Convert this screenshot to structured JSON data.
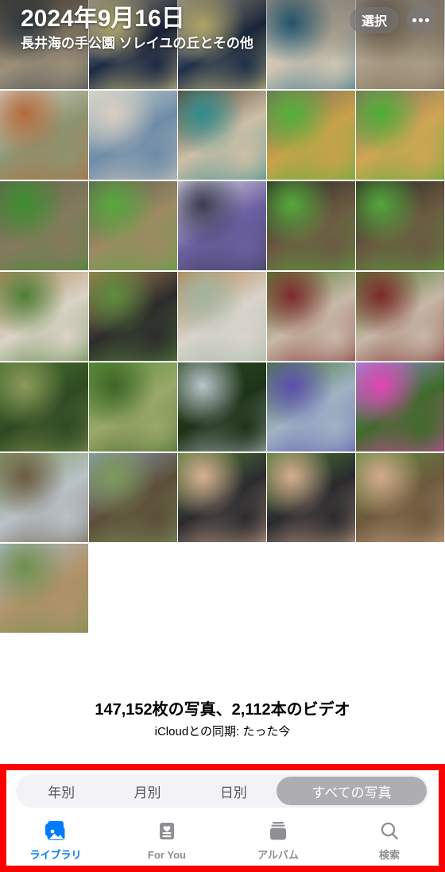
{
  "header": {
    "date": "2024年9月16日",
    "place": "長井海の手公園 ソレイユの丘とその他",
    "select_label": "選択",
    "more_label": "その他",
    "select_icon": "select-icon",
    "more_icon": "ellipsis-icon"
  },
  "summary": {
    "count_text": "147,152枚の写真、2,112本のビデオ",
    "sync_text": "iCloudとの同期: たった今",
    "photo_count": "147,152",
    "video_count": "2,112"
  },
  "segmented": {
    "options": [
      {
        "label": "年別",
        "selected": false
      },
      {
        "label": "月別",
        "selected": false
      },
      {
        "label": "日別",
        "selected": false
      },
      {
        "label": "すべての写真",
        "selected": true
      }
    ],
    "selected_label": "すべての写真"
  },
  "tabs": [
    {
      "label": "ライブラリ",
      "icon": "photo-stack-icon",
      "active": true
    },
    {
      "label": "For You",
      "icon": "heart-card-icon",
      "active": false
    },
    {
      "label": "アルバム",
      "icon": "albums-stack-icon",
      "active": false
    },
    {
      "label": "検索",
      "icon": "search-icon",
      "active": false
    }
  ],
  "colors": {
    "accent": "#007AFF",
    "inactive": "#8E8E93",
    "highlight_border": "#FF0000",
    "segment_track": "#F2F2F7",
    "segment_selected": "#AEAEB2"
  },
  "grid": {
    "columns": 5,
    "total_visible": 31,
    "rows": [
      [
        {
          "desc": "driftwood-shell-display",
          "c1": "#6d6454",
          "c2": "#3c4a52",
          "c3": "#9d8f79"
        },
        {
          "desc": "table-setting-plates-spoon",
          "c1": "#ddd6cb",
          "c2": "#e8d98b",
          "c3": "#1e2a44"
        },
        {
          "desc": "table-setting-plates-fork",
          "c1": "#dcd4c8",
          "c2": "#e6d787",
          "c3": "#203049"
        },
        {
          "desc": "clam-shell-seaglass",
          "c1": "#e2dcd2",
          "c2": "#2e6f8e",
          "c3": "#cfc4b0"
        },
        {
          "desc": "seashell-collection-lace",
          "c1": "#d9d2c6",
          "c2": "#7d6a52",
          "c3": "#a99c86"
        }
      ],
      [
        {
          "desc": "shell-dishes-tray",
          "c1": "#d7d1c7",
          "c2": "#b46a3c",
          "c3": "#8d9470"
        },
        {
          "desc": "shells-in-wine-glasses",
          "c1": "#cfd6cc",
          "c2": "#d9cfc2",
          "c3": "#6e8ca8"
        },
        {
          "desc": "hanging-shell-mobile",
          "c1": "#5a4434",
          "c2": "#2e8d8d",
          "c3": "#cdbfa6"
        },
        {
          "desc": "terrarium-rocks-moss",
          "c1": "#6e6a5c",
          "c2": "#53b03a",
          "c3": "#c9a24a"
        },
        {
          "desc": "terrarium-driftwood-fern",
          "c1": "#7a7162",
          "c2": "#4fae36",
          "c3": "#d0a554"
        }
      ],
      [
        {
          "desc": "aquascape-moss-rocks",
          "c1": "#5f6350",
          "c2": "#3e8f2e",
          "c3": "#857a5e"
        },
        {
          "desc": "aquascape-driftwood-plants",
          "c1": "#5b6150",
          "c2": "#57a83c",
          "c3": "#9c8a63"
        },
        {
          "desc": "person-at-egg-display",
          "c1": "#e4e0e6",
          "c2": "#3a3c52",
          "c3": "#6b5fa0"
        },
        {
          "desc": "dark-vivarium-driftwood",
          "c1": "#262522",
          "c2": "#57a93c",
          "c3": "#6b5a42"
        },
        {
          "desc": "dark-vivarium-driftwood-2",
          "c1": "#252421",
          "c2": "#55a73b",
          "c3": "#6a5941"
        }
      ],
      [
        {
          "desc": "kokedama-plant-wood-box",
          "c1": "#b08a5e",
          "c2": "#4e7f36",
          "c3": "#dad3c6"
        },
        {
          "desc": "kokedama-moss-ball-plate",
          "c1": "#a87e52",
          "c2": "#5d8e3e",
          "c3": "#2c2c2c"
        },
        {
          "desc": "glass-bowl-succulents",
          "c1": "#b5824c",
          "c2": "#9fb4a0",
          "c3": "#d9d4cc"
        },
        {
          "desc": "banana-flower-plant",
          "c1": "#4f7c2e",
          "c2": "#7e2a2c",
          "c3": "#c8b9a8"
        },
        {
          "desc": "banana-flower-plant-2",
          "c1": "#4d7a2d",
          "c2": "#7c282a",
          "c3": "#c6b7a6"
        }
      ],
      [
        {
          "desc": "banana-grove-fruit",
          "c1": "#4b7430",
          "c2": "#8b9a5a",
          "c3": "#2f4a22"
        },
        {
          "desc": "banana-leaves-closeup",
          "c1": "#5a9137",
          "c2": "#3d6526",
          "c3": "#9aa86a"
        },
        {
          "desc": "banana-palm-sky",
          "c1": "#2d4a23",
          "c2": "#b9c4cc",
          "c3": "#1e3318"
        },
        {
          "desc": "morning-glory-vine-wall",
          "c1": "#4a7a34",
          "c2": "#5a4fae",
          "c3": "#9fb3c4"
        },
        {
          "desc": "morning-glory-flower-closeup",
          "c1": "#9a8fe0",
          "c2": "#e145b4",
          "c3": "#3f6b2a"
        }
      ],
      [
        {
          "desc": "vegetable-field-rows",
          "c1": "#7f9a5e",
          "c2": "#6b5a42",
          "c3": "#b9c2c8"
        },
        {
          "desc": "vegetable-field-cloudy-sky",
          "c1": "#8a9eb0",
          "c2": "#7d9a5c",
          "c3": "#5d4e3a"
        },
        {
          "desc": "harvesting-okra-hands",
          "c1": "#4f7f33",
          "c2": "#d8b193",
          "c3": "#2b2b2f"
        },
        {
          "desc": "harvesting-okra-hands-2",
          "c1": "#4d7d32",
          "c2": "#d6af91",
          "c3": "#2a2a2e"
        },
        {
          "desc": "holding-okra-stems",
          "c1": "#5a8a3a",
          "c2": "#d4ab8c",
          "c3": "#6e5a3e"
        }
      ],
      [
        {
          "desc": "farm-field-wide-sky",
          "c1": "#a8bed2",
          "c2": "#6f8f4c",
          "c3": "#b09369"
        }
      ]
    ]
  }
}
